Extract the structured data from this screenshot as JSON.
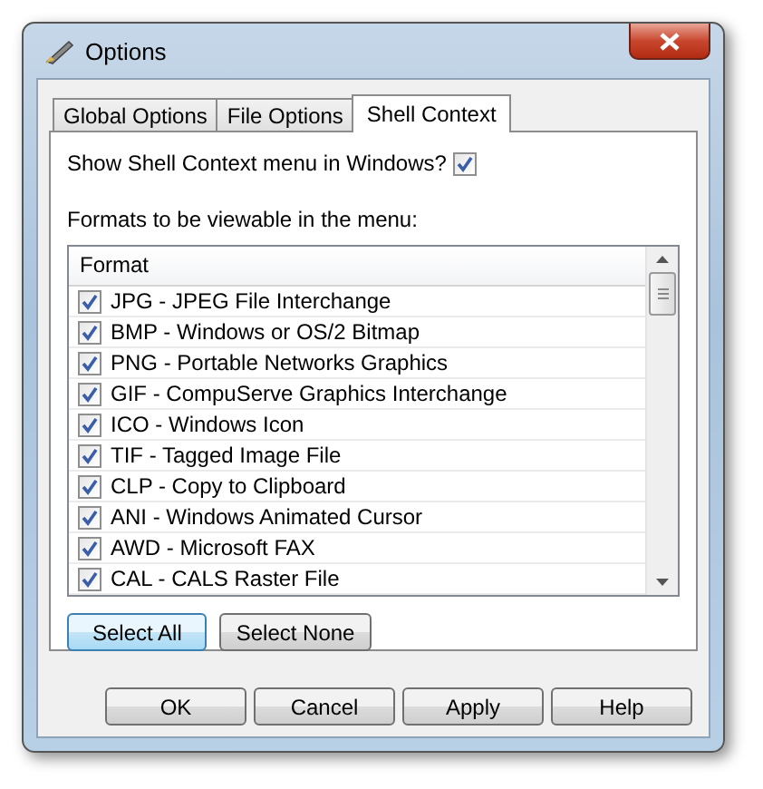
{
  "window": {
    "title": "Options"
  },
  "tabs": [
    {
      "label": "Global Options",
      "selected": false
    },
    {
      "label": "File Options",
      "selected": false
    },
    {
      "label": "Shell Context",
      "selected": true
    }
  ],
  "shell_context": {
    "label": "Show Shell Context menu in Windows?",
    "checked": true
  },
  "formats_label": "Formats to be viewable in the menu:",
  "formats": {
    "column": "Format",
    "rows": [
      {
        "label": "JPG - JPEG File Interchange",
        "checked": true
      },
      {
        "label": "BMP - Windows or OS/2 Bitmap",
        "checked": true
      },
      {
        "label": "PNG - Portable Networks Graphics",
        "checked": true
      },
      {
        "label": "GIF - CompuServe Graphics Interchange",
        "checked": true
      },
      {
        "label": "ICO - Windows Icon",
        "checked": true
      },
      {
        "label": "TIF - Tagged Image File",
        "checked": true
      },
      {
        "label": "CLP - Copy to Clipboard",
        "checked": true
      },
      {
        "label": "ANI - Windows Animated Cursor",
        "checked": true
      },
      {
        "label": "AWD - Microsoft FAX",
        "checked": true
      },
      {
        "label": "CAL - CALS Raster File",
        "checked": true
      }
    ]
  },
  "list_buttons": [
    {
      "label": "Select All",
      "selected": true
    },
    {
      "label": "Select None",
      "selected": false
    }
  ],
  "buttons": [
    "OK",
    "Cancel",
    "Apply",
    "Help"
  ]
}
